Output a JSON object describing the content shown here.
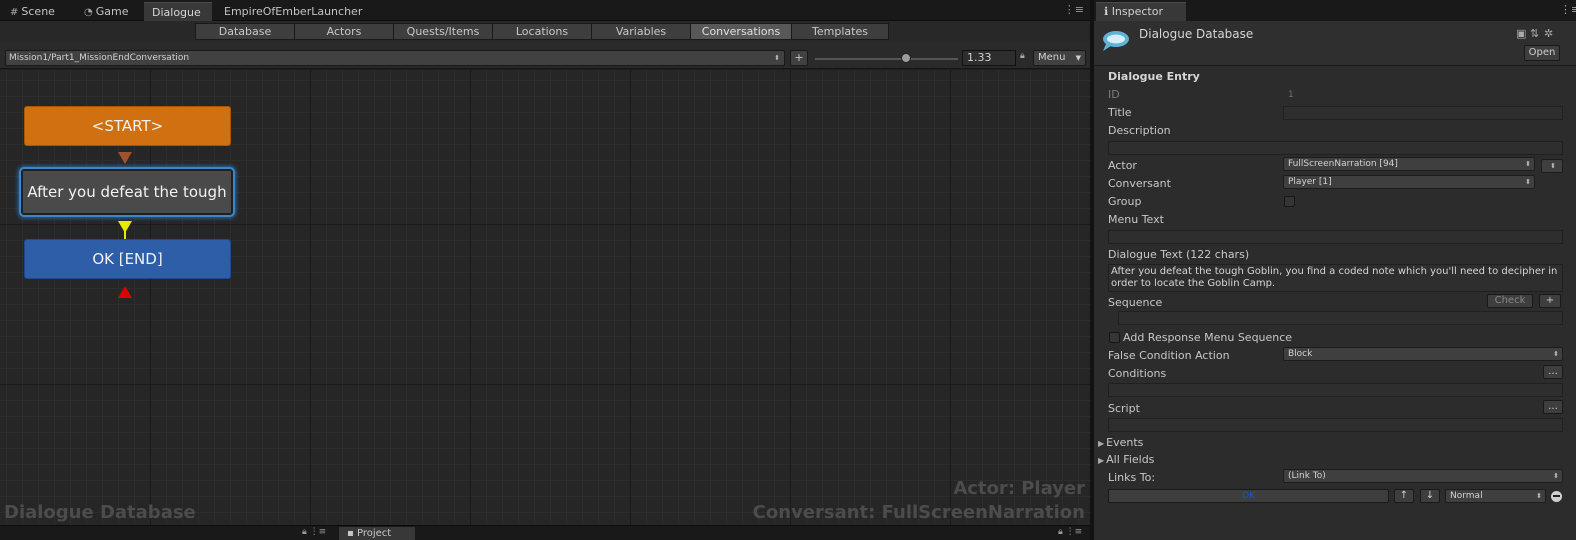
{
  "window_tabs": [
    {
      "label": "Scene",
      "icon": "hash-grid-icon"
    },
    {
      "label": "Game",
      "icon": "pacman-icon"
    },
    {
      "label": "Dialogue"
    },
    {
      "label": "EmpireOfEmberLauncher"
    }
  ],
  "db_tabs": [
    "Database",
    "Actors",
    "Quests/Items",
    "Locations",
    "Variables",
    "Conversations",
    "Templates"
  ],
  "active_db_tab": "Conversations",
  "toolbar": {
    "conversation": "Mission1/Part1_MissionEndConversation",
    "add_label": "+",
    "zoom": "1.33",
    "menu_label": "Menu"
  },
  "canvas": {
    "start_label": "<START>",
    "dialogue_label": "After you defeat the tough",
    "end_label": "OK [END]",
    "watermark_left": "Dialogue Database",
    "watermark_actor": "Actor: Player",
    "watermark_conversant": "Conversant: FullScreenNarration"
  },
  "bottom": {
    "project_tab": "Project"
  },
  "inspector": {
    "tab": "Inspector",
    "title": "Dialogue Database",
    "open_label": "Open",
    "section": "Dialogue Entry",
    "id_label": "ID",
    "id_value": "1",
    "title_label": "Title",
    "title_value": "",
    "description_label": "Description",
    "actor_label": "Actor",
    "actor_value": "FullScreenNarration [94]",
    "conversant_label": "Conversant",
    "conversant_value": "Player [1]",
    "group_label": "Group",
    "menu_text_label": "Menu Text",
    "dialogue_text_label": "Dialogue Text (122 chars)",
    "dialogue_text": "After you defeat the tough Goblin, you find a coded note which you'll need to decipher in order to locate the Goblin Camp.",
    "sequence_label": "Sequence",
    "check_label": "Check",
    "plus_label": "+",
    "add_response_label": "Add Response Menu Sequence",
    "false_condition_label": "False Condition Action",
    "false_condition_value": "Block",
    "conditions_label": "Conditions",
    "ellipsis": "...",
    "script_label": "Script",
    "events_label": "Events",
    "all_fields_label": "All Fields",
    "links_to_label": "Links To:",
    "links_to_value": "(Link To)",
    "link_ok": "OK",
    "link_priority": "Normal",
    "up_arrow": "↑",
    "down_arrow": "↓"
  },
  "colors": {
    "start": "#d07010",
    "dialogue": "#4a4a4a",
    "end": "#2e5ea8",
    "selection": "#3a86c8",
    "link_ok": "#2050e0"
  }
}
